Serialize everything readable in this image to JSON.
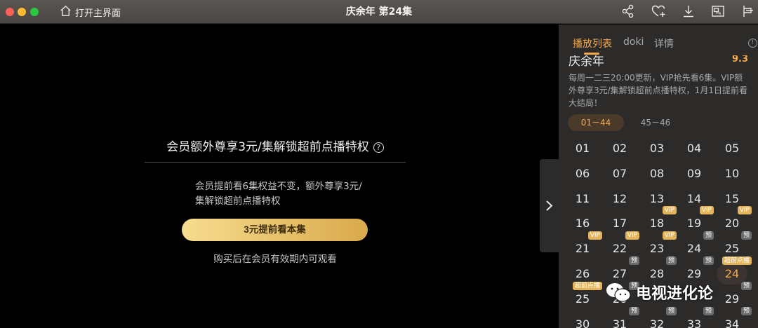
{
  "window": {
    "title": "庆余年 第24集",
    "home_label": "打开主界面",
    "toolbar_icons": [
      "share-icon",
      "favorite-add-icon",
      "download-icon",
      "picture-in-picture-icon",
      "pin-icon"
    ]
  },
  "player": {
    "paywall_title": "会员额外尊享3元/集解锁超前点播特权",
    "help_symbol": "?",
    "description": "会员提前看6集权益不变，额外尊享3元/集解锁超前点播特权",
    "button_label": "3元提前看本集",
    "note": "购买后在会员有效期内可观看"
  },
  "sidebar": {
    "tabs": [
      {
        "label": "播放列表",
        "active": true
      },
      {
        "label": "doki",
        "active": false
      },
      {
        "label": "详情",
        "active": false
      }
    ],
    "show_name": "庆余年",
    "score": "9.3",
    "description": "每周一二三20:00更新，VIP抢先看6集。VIP额外尊享3元/集解锁超前点播特权，1月1日提前看大结局！",
    "ranges": [
      {
        "label": "01－44",
        "active": true
      },
      {
        "label": "45－46",
        "active": false
      }
    ],
    "episodes": [
      {
        "num": "01",
        "badge": ""
      },
      {
        "num": "02",
        "badge": ""
      },
      {
        "num": "03",
        "badge": ""
      },
      {
        "num": "04",
        "badge": ""
      },
      {
        "num": "05",
        "badge": ""
      },
      {
        "num": "06",
        "badge": ""
      },
      {
        "num": "07",
        "badge": ""
      },
      {
        "num": "08",
        "badge": ""
      },
      {
        "num": "09",
        "badge": ""
      },
      {
        "num": "10",
        "badge": ""
      },
      {
        "num": "11",
        "badge": ""
      },
      {
        "num": "12",
        "badge": ""
      },
      {
        "num": "13",
        "badge": ""
      },
      {
        "num": "14",
        "badge": ""
      },
      {
        "num": "15",
        "badge": ""
      },
      {
        "num": "16",
        "badge": ""
      },
      {
        "num": "17",
        "badge": ""
      },
      {
        "num": "18",
        "badge": "VIP"
      },
      {
        "num": "19",
        "badge": "VIP"
      },
      {
        "num": "20",
        "badge": "VIP"
      },
      {
        "num": "21",
        "badge": "VIP"
      },
      {
        "num": "22",
        "badge": "VIP"
      },
      {
        "num": "23",
        "badge": "VIP"
      },
      {
        "num": "24",
        "badge": "预"
      },
      {
        "num": "25",
        "badge": "预"
      },
      {
        "num": "26",
        "badge": ""
      },
      {
        "num": "27",
        "badge": "预"
      },
      {
        "num": "28",
        "badge": "预"
      },
      {
        "num": "29",
        "badge": "预"
      },
      {
        "num": "24",
        "badge": "超前点播",
        "current": true
      },
      {
        "num": "25",
        "badge": "超前点播"
      },
      {
        "num": "26",
        "badge": "预"
      },
      {
        "num": "",
        "badge": ""
      },
      {
        "num": "",
        "badge": ""
      },
      {
        "num": "29",
        "badge": "预"
      },
      {
        "num": "30",
        "badge": ""
      },
      {
        "num": "31",
        "badge": "预"
      },
      {
        "num": "32",
        "badge": "预"
      },
      {
        "num": "33",
        "badge": "预"
      },
      {
        "num": "34",
        "badge": "预"
      }
    ]
  },
  "watermark": {
    "text": "电视进化论"
  }
}
